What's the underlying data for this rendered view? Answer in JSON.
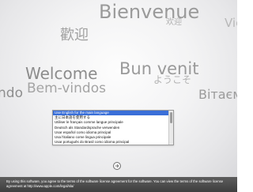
{
  "welcome_screen": {
    "greetings": {
      "bienvenue": "Bienvenue",
      "chinese": "欢迎",
      "view": "View",
      "kanji": "歡迎",
      "welcome": "Welcome",
      "bun_venit": "Bun venit",
      "youkoso": "ようこそ",
      "bem_vindos": "Bem-vindos",
      "ndo": "ndo",
      "vitaemo": "Вітаємо"
    },
    "language_list": {
      "items": [
        "Use English for the main language",
        "主に日本語を使用する",
        "Utiliser le français comme langue principale",
        "Deutsch als Standardsprache verwenden",
        "Usar español como idioma principal",
        "Usa l'italiano come lingua principale",
        "Usar português do Brasil como idioma principal"
      ],
      "selected_index": 0,
      "colors": {
        "selection": "#3a6fd8",
        "text": "#111111"
      }
    },
    "continue_button": {
      "icon": "right-arrow-icon"
    },
    "footer": {
      "text": "By using this software, you agree to the terms of the software license agreement for the software. You can view the terms of the software license agreement at http://www.apple.com/legal/sla/"
    }
  }
}
